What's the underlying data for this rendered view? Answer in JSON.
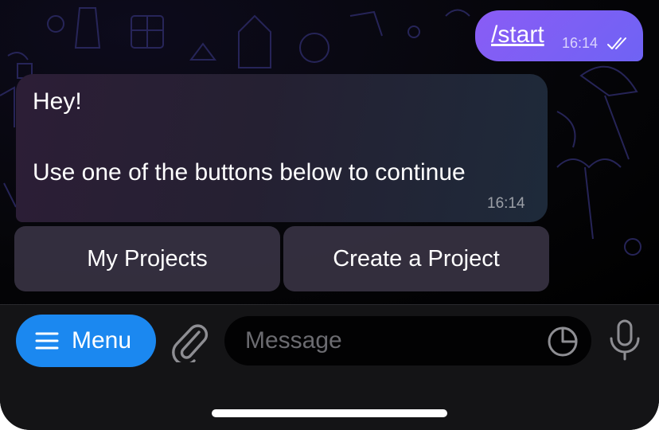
{
  "chat": {
    "outgoing": {
      "text": "/start",
      "time": "16:14",
      "status_icon": "double-check-icon"
    },
    "incoming": {
      "line1": "Hey!",
      "line2": "Use one of the buttons below to continue",
      "time": "16:14"
    },
    "inline_keyboard": [
      {
        "label": "My Projects"
      },
      {
        "label": "Create a Project"
      }
    ]
  },
  "input_bar": {
    "menu_label": "Menu",
    "menu_icon": "hamburger-icon",
    "attach_icon": "paperclip-icon",
    "placeholder": "Message",
    "sticker_icon": "sticker-icon",
    "mic_icon": "microphone-icon"
  },
  "colors": {
    "outgoing_bubble": "#7b60f5",
    "menu_button": "#1b88f0",
    "panel": "#141416",
    "keyboard_button": "#3a3446"
  }
}
